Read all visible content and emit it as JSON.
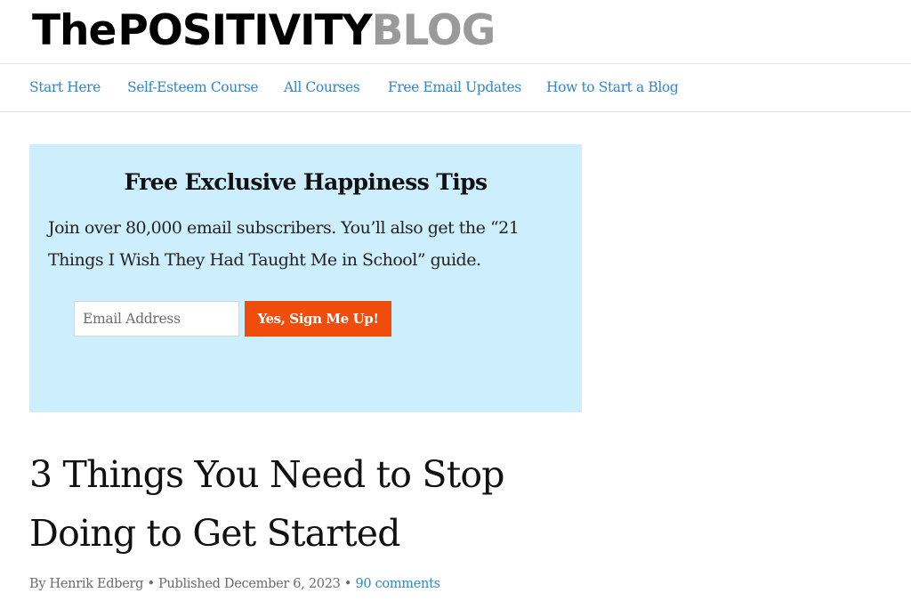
{
  "logo": {
    "the": "The",
    "positivity": "POSITIVITY",
    "blog": "BLOG"
  },
  "nav": {
    "items": [
      {
        "label": "Start Here"
      },
      {
        "label": "Self-Esteem Course"
      },
      {
        "label": "All Courses"
      },
      {
        "label": "Free Email Updates"
      },
      {
        "label": "How to Start a Blog"
      }
    ]
  },
  "optin": {
    "heading": "Free Exclusive Happiness Tips",
    "body": "Join over 80,000 email subscribers. You’ll also get the “21 Things I Wish They Had Taught Me in School” guide.",
    "email_placeholder": "Email Address",
    "email_value": "",
    "button_label": "Yes, Sign Me Up!"
  },
  "post": {
    "title": "3 Things You Need to Stop Doing to Get Started",
    "byline": "By Henrik Edberg",
    "separator": "•",
    "published": "Published December 6, 2023",
    "comments": "90 comments"
  },
  "colors": {
    "accent_link": "#2e87d1",
    "optin_background": "#cdeefc",
    "button_background": "#f04c0c",
    "logo_grey": "#9a9a9a"
  }
}
